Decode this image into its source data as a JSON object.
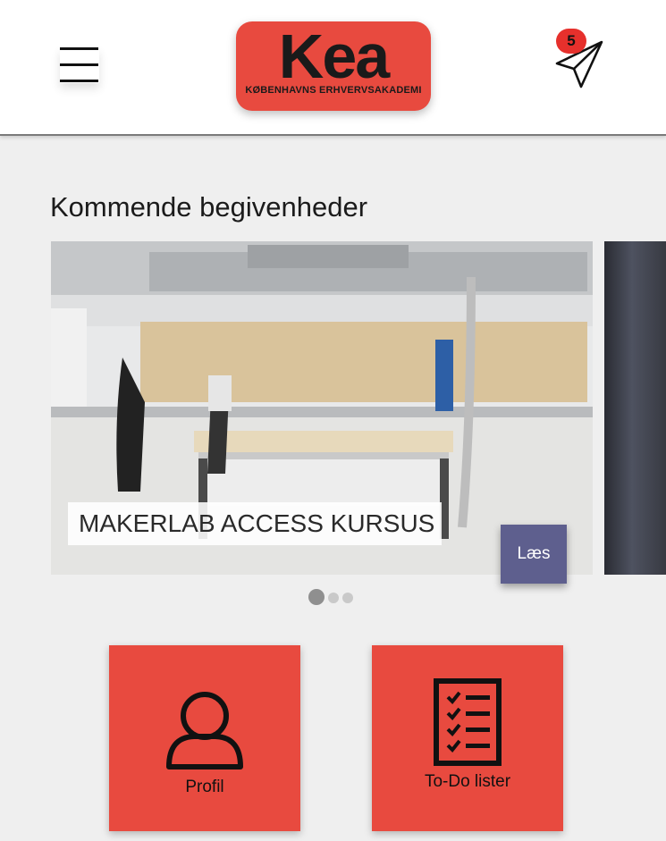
{
  "header": {
    "logo": {
      "word": "Kea",
      "subtitle": "KØBENHAVNS ERHVERVSAKADEMI",
      "color": "#e84a3f"
    },
    "notifications": {
      "count": "5",
      "icon": "paper-plane-icon"
    },
    "menu_icon": "hamburger-menu-icon"
  },
  "events": {
    "title": "Kommende begivenheder",
    "slides": [
      {
        "title": "MAKERLAB ACCESS KURSUS",
        "button_label": "Læs"
      }
    ],
    "carousel": {
      "count": 3,
      "active": 0
    }
  },
  "tiles": [
    {
      "label": "Profil",
      "icon": "person-icon"
    },
    {
      "label": "To-Do lister",
      "icon": "checklist-icon"
    }
  ],
  "colors": {
    "accent": "#e84a3f",
    "button": "#5e5f8e",
    "background": "#efefef"
  }
}
